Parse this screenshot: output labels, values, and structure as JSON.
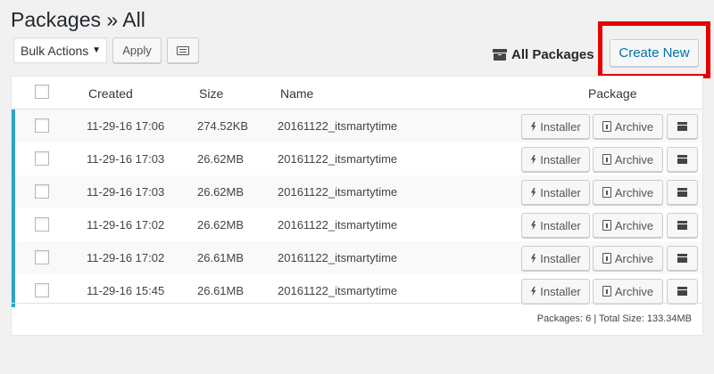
{
  "page": {
    "title": "Packages » All"
  },
  "toolbar": {
    "bulk_actions": "Bulk Actions",
    "apply_label": "Apply"
  },
  "header_right": {
    "all_packages_label": "All Packages",
    "create_new_label": "Create New"
  },
  "table": {
    "columns": {
      "created": "Created",
      "size": "Size",
      "name": "Name",
      "package": "Package"
    },
    "rows": [
      {
        "created": "11-29-16 17:06",
        "size": "274.52KB",
        "name": "20161122_itsmartytime"
      },
      {
        "created": "11-29-16 17:03",
        "size": "26.62MB",
        "name": "20161122_itsmartytime"
      },
      {
        "created": "11-29-16 17:03",
        "size": "26.62MB",
        "name": "20161122_itsmartytime"
      },
      {
        "created": "11-29-16 17:02",
        "size": "26.62MB",
        "name": "20161122_itsmartytime"
      },
      {
        "created": "11-29-16 17:02",
        "size": "26.61MB",
        "name": "20161122_itsmartytime"
      },
      {
        "created": "11-29-16 15:45",
        "size": "26.61MB",
        "name": "20161122_itsmartytime"
      }
    ],
    "installer_label": "Installer",
    "archive_label": "Archive",
    "footer": "Packages: 6 | Total Size: 133.34MB"
  },
  "colors": {
    "accent": "#0073aa",
    "highlight_border": "#e40000",
    "row_marker": "#2ea2cc"
  }
}
